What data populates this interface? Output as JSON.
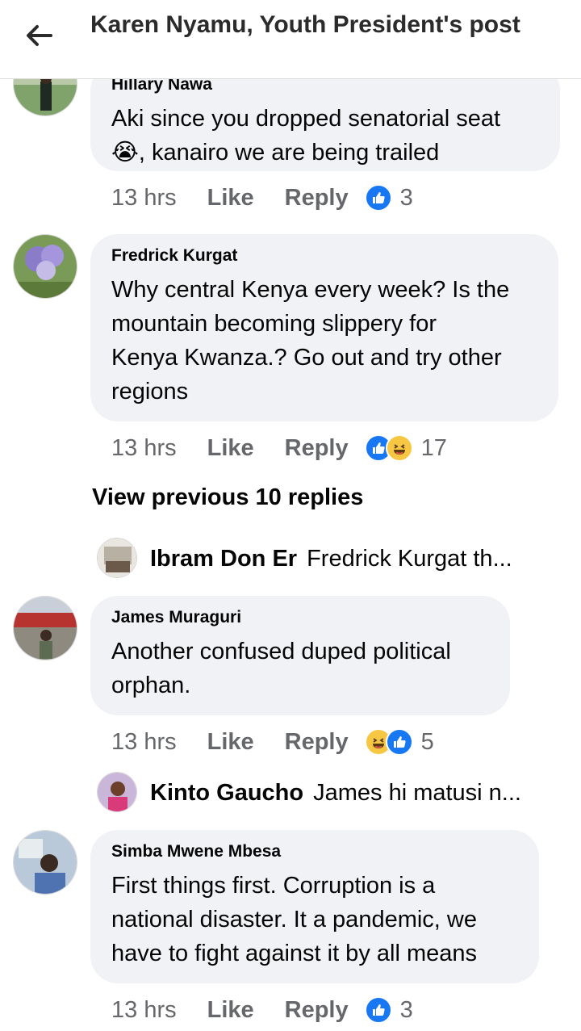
{
  "header": {
    "title": "Karen Nyamu, Youth President's post"
  },
  "comments": [
    {
      "name": "Hillary Nawa",
      "text_line1": "Aki since you dropped senatorial seat",
      "text_line2": ", kanairo we are being trailed",
      "emoji": "😭",
      "time": "13 hrs",
      "like": "Like",
      "reply": "Reply",
      "reaction_count": "3"
    },
    {
      "name": "Fredrick Kurgat",
      "lines": [
        "Why central Kenya every week? Is the",
        "mountain becoming slippery for",
        "Kenya Kwanza.?  Go out and try other",
        "regions"
      ],
      "time": "13 hrs",
      "like": "Like",
      "reply": "Reply",
      "reaction_count": "17"
    },
    {
      "name": "James Muraguri",
      "lines": [
        "Another confused duped political",
        "orphan."
      ],
      "time": "13 hrs",
      "like": "Like",
      "reply": "Reply",
      "reaction_count": "5"
    },
    {
      "name": "Simba Mwene Mbesa",
      "lines": [
        "First things first. Corruption is a",
        "national disaster. It a pandemic, we",
        "have to fight against it by all means"
      ],
      "time": "13 hrs",
      "like": "Like",
      "reply": "Reply",
      "reaction_count": "3"
    }
  ],
  "view_previous": "View previous 10 replies",
  "reply_previews": [
    {
      "name": "Ibram Don Er",
      "text": "Fredrick Kurgat th..."
    },
    {
      "name": "Kinto Gaucho",
      "text": "James hi matusi n..."
    }
  ],
  "colors": {
    "like_blue": "#1877f2",
    "bubble_bg": "#f0f2f5",
    "meta_gray": "#65676b",
    "haha_yellow": "#f7c744"
  }
}
